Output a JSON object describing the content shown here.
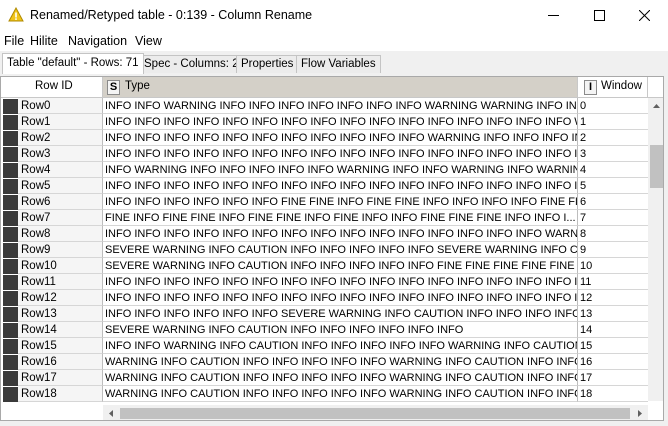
{
  "window": {
    "title": "Renamed/Retyped table - 0:139 - Column Rename",
    "controls": {
      "minimize": "minimize",
      "maximize": "maximize",
      "close": "close"
    }
  },
  "menu": [
    "File",
    "Hilite",
    "Navigation",
    "View"
  ],
  "tabs": [
    {
      "label": "Table \"default\" - Rows: 71",
      "active": true
    },
    {
      "label": "Spec - Columns: 2",
      "active": false
    },
    {
      "label": "Properties",
      "active": false
    },
    {
      "label": "Flow Variables",
      "active": false
    }
  ],
  "table": {
    "headers": {
      "row_id": "Row ID",
      "type_badge": "S",
      "type": "Type",
      "window_badge": "I",
      "window": "Window"
    },
    "rows": [
      {
        "id": "Row0",
        "type": "INFO INFO WARNING INFO INFO INFO INFO INFO INFO INFO WARNING WARNING INFO INF...",
        "window": "0"
      },
      {
        "id": "Row1",
        "type": "INFO INFO INFO INFO INFO INFO INFO INFO INFO INFO INFO INFO INFO INFO INFO INFO W...",
        "window": "1"
      },
      {
        "id": "Row2",
        "type": "INFO INFO INFO INFO INFO INFO INFO INFO INFO INFO INFO WARNING INFO INFO INFO IN...",
        "window": "2"
      },
      {
        "id": "Row3",
        "type": "INFO INFO INFO INFO INFO INFO INFO INFO INFO INFO INFO INFO INFO INFO INFO INFO IN...",
        "window": "3"
      },
      {
        "id": "Row4",
        "type": "INFO WARNING INFO INFO INFO INFO INFO WARNING INFO INFO WARNING INFO WARNING INFO ...",
        "window": "4"
      },
      {
        "id": "Row5",
        "type": "INFO INFO INFO INFO INFO INFO INFO INFO INFO INFO INFO INFO INFO INFO INFO INFO IN...",
        "window": "5"
      },
      {
        "id": "Row6",
        "type": "INFO INFO INFO INFO INFO INFO FINE FINE INFO FINE FINE INFO INFO INFO INFO FINE FINE...",
        "window": "6"
      },
      {
        "id": "Row7",
        "type": "FINE INFO FINE FINE INFO FINE FINE INFO FINE INFO INFO FINE FINE FINE INFO INFO I...",
        "window": "7"
      },
      {
        "id": "Row8",
        "type": "INFO INFO INFO INFO INFO INFO INFO INFO INFO INFO INFO INFO INFO INFO INFO WARNI...",
        "window": "8"
      },
      {
        "id": "Row9",
        "type": "SEVERE WARNING INFO CAUTION INFO INFO INFO INFO INFO SEVERE WARNING INFO CAUTI...",
        "window": "9"
      },
      {
        "id": "Row10",
        "type": "SEVERE WARNING INFO CAUTION INFO INFO INFO INFO INFO FINE FINE FINE FINE FINE FIN...",
        "window": "10"
      },
      {
        "id": "Row11",
        "type": "INFO INFO INFO INFO INFO INFO INFO INFO INFO INFO INFO INFO INFO INFO INFO INFO IN...",
        "window": "11"
      },
      {
        "id": "Row12",
        "type": "INFO INFO INFO INFO INFO INFO INFO INFO INFO INFO INFO INFO INFO INFO INFO INFO IN...",
        "window": "12"
      },
      {
        "id": "Row13",
        "type": "INFO INFO INFO INFO INFO INFO SEVERE WARNING INFO CAUTION INFO INFO INFO INFO INFO S...",
        "window": "13"
      },
      {
        "id": "Row14",
        "type": "SEVERE WARNING INFO CAUTION INFO INFO INFO INFO INFO INFO",
        "window": "14"
      },
      {
        "id": "Row15",
        "type": "INFO INFO WARNING INFO CAUTION INFO INFO INFO INFO INFO WARNING INFO CAUTION",
        "window": "15"
      },
      {
        "id": "Row16",
        "type": "WARNING INFO CAUTION INFO INFO INFO INFO INFO WARNING INFO CAUTION INFO INFO I...",
        "window": "16"
      },
      {
        "id": "Row17",
        "type": "WARNING INFO CAUTION INFO INFO INFO INFO INFO WARNING INFO CAUTION INFO INFO I...",
        "window": "17"
      },
      {
        "id": "Row18",
        "type": "WARNING INFO CAUTION INFO INFO INFO INFO INFO WARNING INFO CAUTION INFO INFO I...",
        "window": "18"
      }
    ]
  },
  "colors": {
    "header_type_bg": "#d4d0c8",
    "row_marker": "#3a3a3a",
    "app_icon": "#f0c419"
  }
}
